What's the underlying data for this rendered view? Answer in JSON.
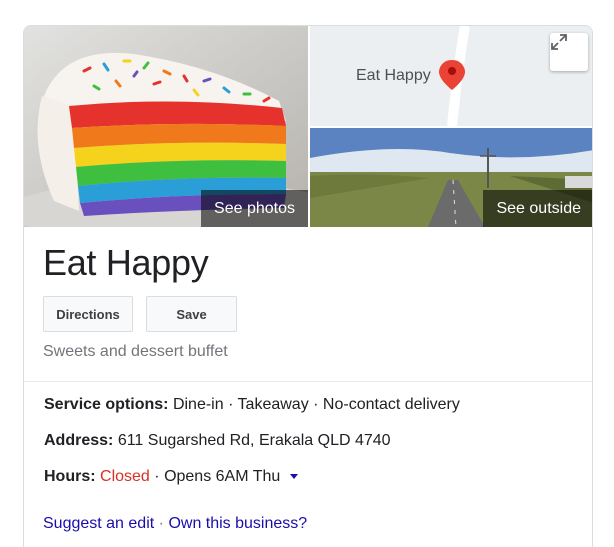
{
  "media": {
    "photos_label": "See photos",
    "outside_label": "See outside",
    "map_label": "Eat Happy",
    "expand_icon": "expand-icon",
    "pin_icon": "map-pin-icon"
  },
  "business": {
    "name": "Eat Happy",
    "category": "Sweets and dessert buffet"
  },
  "actions": {
    "directions_label": "Directions",
    "save_label": "Save"
  },
  "details": {
    "service_options": {
      "label": "Service options:",
      "value": "Dine-in · Takeaway · No-contact delivery"
    },
    "address": {
      "label": "Address:",
      "value": "611 Sugarshed Rd, Erakala QLD 4740"
    },
    "hours": {
      "label": "Hours:",
      "status": "Closed",
      "separator": "·",
      "next": "Opens 6AM Thu"
    }
  },
  "footer": {
    "suggest_edit": "Suggest an edit",
    "separator": "·",
    "own_business": "Own this business?"
  },
  "colors": {
    "closed": "#d93025",
    "link": "#1a0dab",
    "pin": "#ea4335"
  }
}
